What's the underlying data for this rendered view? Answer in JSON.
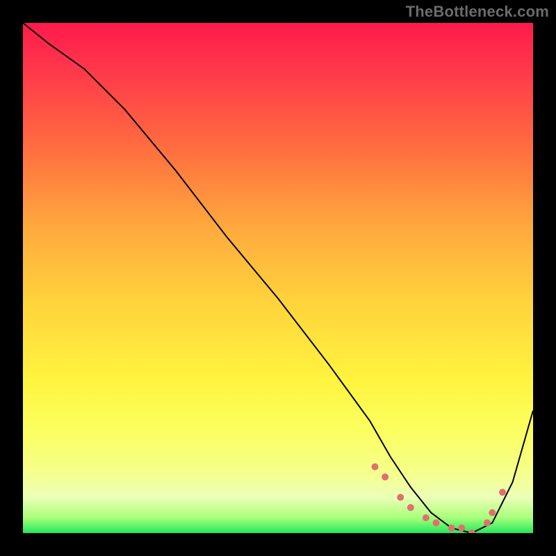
{
  "watermark": "TheBottleneck.com",
  "chart_data": {
    "type": "line",
    "title": "",
    "xlabel": "",
    "ylabel": "",
    "xlim": [
      0,
      100
    ],
    "ylim": [
      0,
      100
    ],
    "series": [
      {
        "name": "curve",
        "x": [
          0,
          5,
          12,
          20,
          30,
          40,
          50,
          60,
          68,
          72,
          76,
          80,
          84,
          88,
          92,
          96,
          100
        ],
        "y": [
          100,
          96,
          91,
          83,
          71,
          58,
          46,
          33,
          22,
          15,
          9,
          4,
          1,
          0,
          2,
          10,
          24
        ]
      }
    ],
    "markers": {
      "name": "highlight-dots",
      "color": "#e07070",
      "x": [
        69,
        71,
        74,
        76,
        79,
        81,
        84,
        86,
        88,
        91,
        92,
        94
      ],
      "y": [
        13,
        11,
        7,
        5,
        3,
        2,
        1,
        1,
        0,
        2,
        4,
        8
      ]
    },
    "gradient_stops": [
      {
        "pos": 0,
        "color": "#ff1a4d"
      },
      {
        "pos": 25,
        "color": "#ff6f3f"
      },
      {
        "pos": 55,
        "color": "#ffd43c"
      },
      {
        "pos": 80,
        "color": "#fbff60"
      },
      {
        "pos": 97,
        "color": "#a8ff7a"
      },
      {
        "pos": 100,
        "color": "#22e85c"
      }
    ]
  }
}
